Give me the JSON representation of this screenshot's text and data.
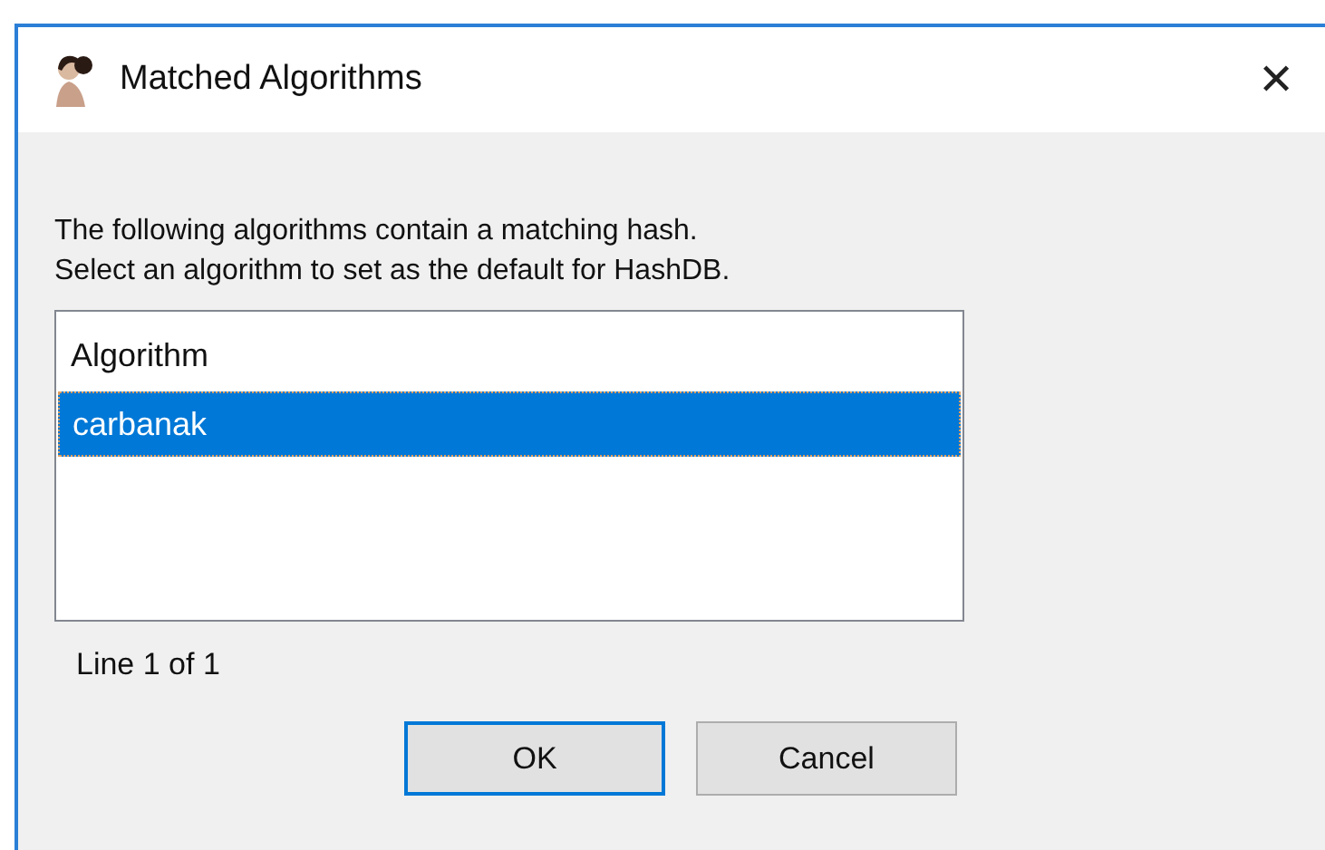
{
  "window": {
    "title": "Matched Algorithms",
    "close": "✕"
  },
  "message": [
    "The following algorithms contain a matching hash.",
    "Select an algorithm to set as the default for HashDB."
  ],
  "list": {
    "column": "Algorithm",
    "rows": [
      {
        "label": "carbanak",
        "selected": true
      }
    ]
  },
  "status": "Line 1 of 1",
  "buttons": [
    {
      "label": "OK",
      "default": true
    },
    {
      "label": "Cancel",
      "default": false
    }
  ]
}
